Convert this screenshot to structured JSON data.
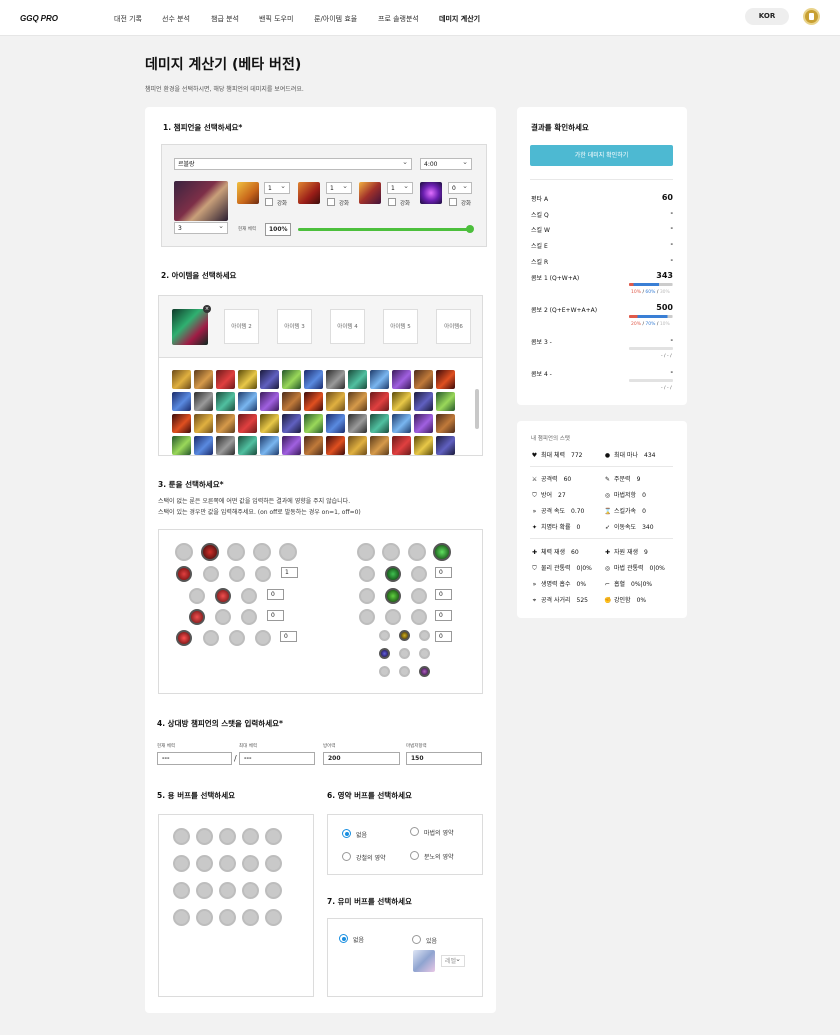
{
  "header": {
    "logo": "GGQ",
    "logo_suffix": "PRO",
    "nav": [
      "대전 기록",
      "선수 분석",
      "챔급 분석",
      "밴픽 도우미",
      "룬/아이템 효율",
      "프로 솔랭분석",
      "데미지 계산기"
    ],
    "active_nav": "데미지 계산기",
    "lang": "KOR"
  },
  "page": {
    "title": "데미지 계산기 (베타 버전)",
    "subtitle": "챔피언 환경을 선택하시면, 해당 챔피언의 데미지를 보여드려요."
  },
  "sec1": {
    "title": "1. 챔피언을 선택하세요*",
    "champion": "르블랑",
    "time": "4:00",
    "level": "3",
    "skills": [
      {
        "level": "1",
        "label": "강화"
      },
      {
        "level": "1",
        "label": "강화"
      },
      {
        "level": "1",
        "label": "강화"
      },
      {
        "level": "0",
        "label": "강화"
      }
    ],
    "health_label": "현재 체력",
    "health_value": "100%",
    "health_fraction": 1.0
  },
  "sec2": {
    "title": "2. 아이템을 선택하세요",
    "slots": [
      "아이템 2",
      "아이템 3",
      "아이템 4",
      "아이템 5",
      "아이템6"
    ]
  },
  "sec3": {
    "title": "3. 룬을 선택하세요*",
    "desc1": "스택이 없는 룬은 오른쪽에 어떤 값을 입력하든 결과에 영향을 주지 않습니다.",
    "desc2": "스택이 있는 경우만 값을 입력해주세요. (on off로 발동하는 경우 on=1, off=0)",
    "left_inputs": [
      "1",
      "0",
      "0",
      "0"
    ],
    "right_inputs": [
      "0",
      "0",
      "0",
      "0"
    ]
  },
  "sec4": {
    "title": "4. 상대방 챔피언의 스탯을 입력하세요*",
    "labels": [
      "현재 체력",
      "최대 체력",
      "방어력",
      "마법저항력"
    ],
    "values": [
      "---",
      "---",
      "200",
      "150"
    ],
    "separator": "/"
  },
  "sec5": {
    "title": "5. 용 버프를 선택하세요"
  },
  "sec6": {
    "title": "6. 영약 버프를 선택하세요",
    "options": [
      "없음",
      "마법의 영약",
      "강철의 영약",
      "분노의 영약"
    ],
    "selected": "없음"
  },
  "sec7": {
    "title": "7. 유미 버프를 선택하세요",
    "options": [
      "없음",
      "있음"
    ],
    "selected": "없음",
    "dropdown": "레벨"
  },
  "result": {
    "title": "결과를 확인하세요",
    "button": "가한 데미지 확인하기",
    "rows": [
      {
        "label": "평타 A",
        "value": "60"
      },
      {
        "label": "스킬 Q",
        "value": "-"
      },
      {
        "label": "스킬 W",
        "value": "-"
      },
      {
        "label": "스킬 E",
        "value": "-"
      },
      {
        "label": "스킬 R",
        "value": "-"
      }
    ],
    "combos": [
      {
        "label": "콤보 1 (Q+W+A)",
        "value": "343",
        "split": [
          "10%",
          "60%",
          "30%"
        ],
        "fill": 0.97
      },
      {
        "label": "콤보 2 (Q+E+W+A+A)",
        "value": "500",
        "split": [
          "20%",
          "70%",
          "10%"
        ],
        "fill": 0.97
      },
      {
        "label": "콤보 3  -",
        "value": "-",
        "split": [
          "-",
          "-",
          ""
        ],
        "fill": 0
      },
      {
        "label": "콤보 4  -",
        "value": "-",
        "split": [
          "-",
          "-",
          ""
        ],
        "fill": 0
      }
    ]
  },
  "stats": {
    "title": "내 챔피언의 스탯",
    "top": [
      {
        "icon": "heart-icon",
        "glyph": "♥",
        "label": "최대 체력",
        "value": "772"
      },
      {
        "icon": "drop-icon",
        "glyph": "●",
        "label": "최대 마나",
        "value": "434"
      }
    ],
    "grid1": [
      {
        "icon": "sword-icon",
        "glyph": "⚔",
        "label": "공격력",
        "value": "60"
      },
      {
        "icon": "wand-icon",
        "glyph": "✎",
        "label": "주문력",
        "value": "9"
      },
      {
        "icon": "shield-icon",
        "glyph": "⛉",
        "label": "방어",
        "value": "27"
      },
      {
        "icon": "mr-icon",
        "glyph": "◎",
        "label": "마법저항",
        "value": "0"
      },
      {
        "icon": "attack-speed-icon",
        "glyph": "»",
        "label": "공격 속도",
        "value": "0.70"
      },
      {
        "icon": "hourglass-icon",
        "glyph": "⌛",
        "label": "스킬가속",
        "value": "0"
      },
      {
        "icon": "crit-icon",
        "glyph": "✦",
        "label": "치명타 확률",
        "value": "0"
      },
      {
        "icon": "boot-icon",
        "glyph": "➶",
        "label": "이동속도",
        "value": "340"
      }
    ],
    "grid2": [
      {
        "icon": "hp-regen-icon",
        "glyph": "✚",
        "label": "체력 재생",
        "value": "60"
      },
      {
        "icon": "mana-regen-icon",
        "glyph": "✚",
        "label": "자원 재생",
        "value": "9"
      },
      {
        "icon": "armor-pen-icon",
        "glyph": "⛉",
        "label": "물리 관통력",
        "value": "0|0%"
      },
      {
        "icon": "magic-pen-icon",
        "glyph": "◎",
        "label": "마법 관통력",
        "value": "0|0%"
      },
      {
        "icon": "lifesteal-icon",
        "glyph": "»",
        "label": "생명력 흡수",
        "value": "0%"
      },
      {
        "icon": "vamp-icon",
        "glyph": "⌐",
        "label": "흡혈",
        "value": "0%|0%"
      },
      {
        "icon": "range-icon",
        "glyph": "⌖",
        "label": "공격 사거리",
        "value": "525"
      },
      {
        "icon": "tenacity-icon",
        "glyph": "✊",
        "label": "강인함",
        "value": "0%"
      }
    ]
  },
  "colors": {
    "accent": "#4db9d2",
    "red": "#e05a4a",
    "blue": "#3a7fd5",
    "grey": "#cccccc"
  }
}
